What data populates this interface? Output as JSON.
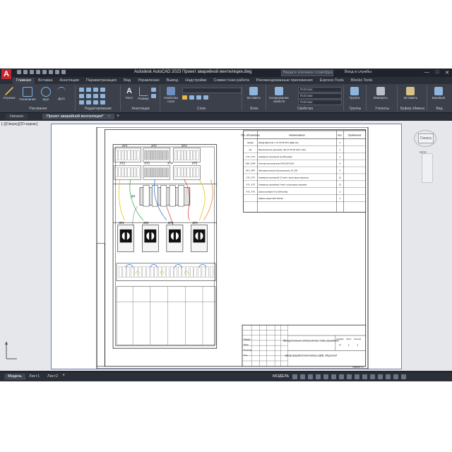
{
  "app": {
    "title": "Autodesk AutoCAD 2023   Проект аварийной вентиляции.dwg",
    "logo_letter": "A",
    "search_placeholder": "Введите ключевое слово/фразу",
    "signin": "Вход в службы",
    "window_controls": [
      "—",
      "□",
      "✕"
    ]
  },
  "ribbon": {
    "tabs": [
      "Главная",
      "Вставка",
      "Аннотации",
      "Параметризация",
      "Вид",
      "Управление",
      "Вывод",
      "Надстройки",
      "Совместная работа",
      "Рекомендованные приложения",
      "Express Tools",
      "Blocks Tools"
    ],
    "active_tab": "Главная",
    "groups": {
      "draw": {
        "title": "Рисование",
        "buttons": [
          "Отрезок",
          "Полилиния",
          "Круг",
          "Дуга"
        ]
      },
      "modify": {
        "title": "Редактирование"
      },
      "annotation": {
        "title": "Аннотации",
        "buttons": [
          "Текст",
          "Размер"
        ]
      },
      "layers": {
        "title": "Слои",
        "buttons": [
          "Свойства слоя"
        ]
      },
      "block": {
        "title": "Блок",
        "buttons": [
          "Вставить"
        ]
      },
      "properties": {
        "title": "Свойства",
        "buttons": [
          "Копирование свойств"
        ],
        "combos": [
          "ПоСлою",
          "ПоСлою",
          "ПоСлою"
        ]
      },
      "groups": {
        "title": "Группы",
        "buttons": [
          "Группа"
        ]
      },
      "utilities": {
        "title": "Утилиты",
        "buttons": [
          "Измерить"
        ]
      },
      "clipboard": {
        "title": "Буфер обмена",
        "buttons": [
          "Вставить"
        ]
      },
      "view": {
        "title": "Вид",
        "buttons": [
          "Базовый"
        ]
      }
    }
  },
  "doc_tabs": {
    "start": "Начало",
    "file": "Проект аварийной вентиляции*",
    "close": "×",
    "plus": "+"
  },
  "viewport": {
    "label": "[–][Сверху][2D-каркас]",
    "viewcube_face": "Сверху",
    "wcs_label": "МСК"
  },
  "drawing": {
    "legend_header": [
      "Поз. обозначение",
      "Наименование",
      "Кол.",
      "Примечание"
    ],
    "legend_rows": [
      [
        "Шкаф",
        "Шкаф ЩРн-24з-1 74 УХЛ3 IP31 (ЩРн-24)",
        "1",
        ""
      ],
      [
        "Q1",
        "Выключатель автомат. ВА 47-29 3Р 16А С 6кА",
        "1",
        ""
      ],
      [
        "XT1..XT4",
        "Клеммник проходной на DIN-рейку",
        "1",
        ""
      ],
      [
        "KM1..KM4",
        "Контактор модульный КМ 20А 2НО",
        "4",
        ""
      ],
      [
        "SF1..SF4",
        "Автоматический выключатель 1Р 10А",
        "4",
        ""
      ],
      [
        "XT2..XT3",
        "Клеммник проходной 2,5 мм² с винтовым зажимом",
        "12",
        ""
      ],
      [
        "XT1..XT3",
        "Клеммник проходной 4 мм² с винтовым зажимом",
        "12",
        ""
      ],
      [
        "XT1..XT3",
        "Шина нулевая N на DIN-рейку",
        "2",
        ""
      ],
      [
        "",
        "Кабель-канал ККП 40×40",
        "1",
        ""
      ]
    ],
    "panel_labels": {
      "xt_top": [
        "XT1",
        "XT2",
        "XT3"
      ],
      "xt_bot": [
        "XT2",
        "XT3",
        "XT4",
        "XT5"
      ],
      "q1": "Q1",
      "breakers": [
        "SF1",
        "SF2",
        "SF3",
        "SF4"
      ]
    },
    "title_block": {
      "title1": "Принципиальная электрическая схема управления",
      "title2": "Шкаф аварийной вентиляции ЩАВ. Общий вид",
      "sheet_info": [
        "Стадия",
        "Лист",
        "Листов"
      ],
      "sheet_values": [
        "Р",
        "1",
        "1"
      ],
      "roles": [
        "Разраб.",
        "Пров.",
        "Н.контр.",
        "Утв."
      ],
      "format": "Формат А3"
    }
  },
  "status": {
    "layouts": [
      "Модель",
      "Лист1",
      "Лист2"
    ],
    "active_layout": "Модель",
    "plus": "+",
    "mode": "МОДЕЛЬ"
  },
  "colors": {
    "app_bg": "#2b2f38",
    "ribbon_bg": "#3b404b",
    "canvas_bg": "#e6e7ea",
    "logo_red": "#c4262e",
    "sheet_border": "#6f7fb2"
  }
}
